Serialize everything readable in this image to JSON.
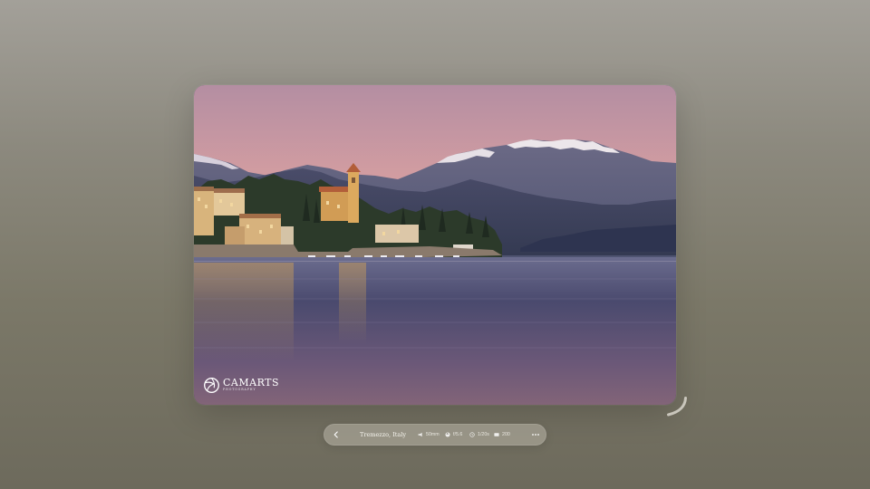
{
  "photo": {
    "subject": "Lakeside village at dusk with snow-capped mountains",
    "colors": {
      "sky_top": "#b98a9e",
      "sky_bottom": "#e0a59c",
      "mountains": "#5e5f7b",
      "water": "#4d4a6e"
    }
  },
  "watermark": {
    "brand": "CAMARTS",
    "tagline": "PHOTOGRAPHY",
    "icon": "aperture-logo-icon"
  },
  "toolbar": {
    "back_icon": "chevron-left-icon",
    "location": "Tremezzo, Italy",
    "focal_length": "50mm",
    "aperture": "f/5.6",
    "shutter": "1/20s",
    "iso": "200",
    "more_icon": "ellipsis-icon"
  },
  "window": {
    "resize_icon": "resize-handle-icon"
  }
}
